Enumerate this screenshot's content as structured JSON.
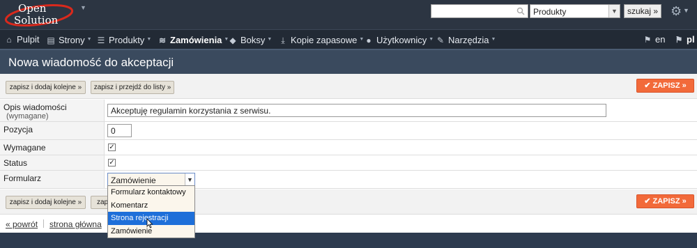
{
  "logo": {
    "line1": "Open",
    "line2": "Solution"
  },
  "search": {
    "value": "",
    "placeholder": ""
  },
  "search_scope": {
    "selected": "Produkty"
  },
  "search_button": "szukaj »",
  "nav": {
    "items": [
      {
        "label": "Pulpit",
        "icon": "home-icon"
      },
      {
        "label": "Strony",
        "icon": "document-icon"
      },
      {
        "label": "Produkty",
        "icon": "list-icon"
      },
      {
        "label": "Zamówienia",
        "icon": "orders-icon"
      },
      {
        "label": "Boksy",
        "icon": "box-icon"
      },
      {
        "label": "Kopie zapasowe",
        "icon": "download-icon"
      },
      {
        "label": "Użytkownicy",
        "icon": "user-icon"
      },
      {
        "label": "Narzędzia",
        "icon": "wrench-icon"
      }
    ],
    "lang_en": "en",
    "lang_pl": "pl"
  },
  "page_title": "Nowa wiadomość do akceptacji",
  "toolbar": {
    "save_add": "zapisz i dodaj kolejne »",
    "save_list": "zapisz i przejdź do listy »",
    "save": "ZAPISZ »"
  },
  "form": {
    "opis_label": "Opis wiadomości",
    "opis_sub": "(wymagane)",
    "opis_value": "Akceptuję regulamin korzystania z serwisu.",
    "pozycja_label": "Pozycja",
    "pozycja_value": "0",
    "wymagane_label": "Wymagane",
    "wymagane_checked": true,
    "status_label": "Status",
    "status_checked": true,
    "formularz_label": "Formularz",
    "formularz_selected": "Zamówienie",
    "formularz_options": [
      "Formularz kontaktowy",
      "Komentarz",
      "Strona rejestracji",
      "Zamówienie"
    ],
    "formularz_highlighted": "Strona rejestracji"
  },
  "toolbar_bottom": {
    "save_add": "zapisz i dodaj kolejne »",
    "save_list_partial": "zapis",
    "save": "ZAPISZ »"
  },
  "footer": {
    "back": "« powrót",
    "home": "strona główna"
  },
  "colors": {
    "accent": "#f26a3a",
    "nav_bg": "#222a35",
    "header_bg": "#3a4a5e",
    "highlight": "#1e6fd9"
  }
}
